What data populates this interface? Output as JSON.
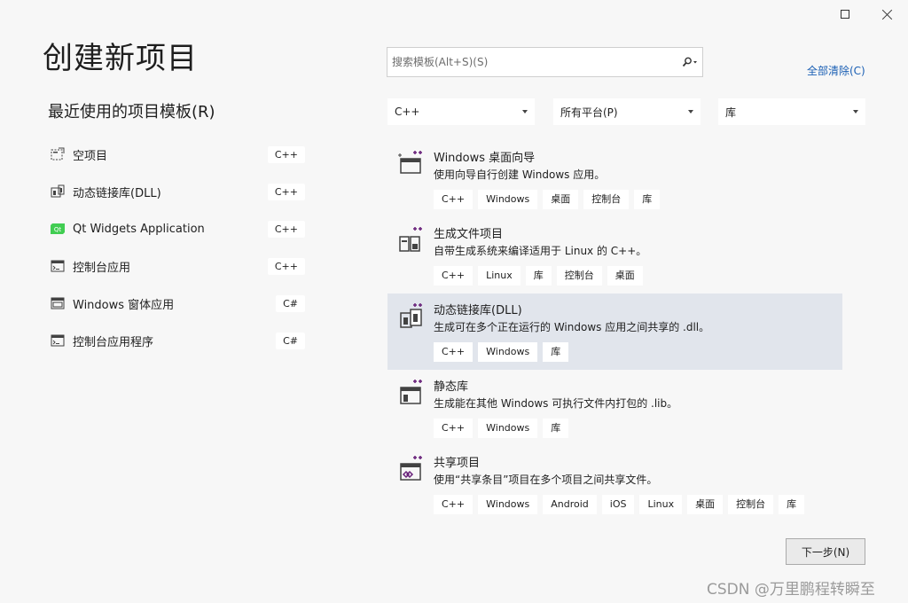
{
  "window": {
    "maximize_icon": "maximize-icon",
    "close_icon": "close-icon"
  },
  "page_title": "创建新项目",
  "recent": {
    "title": "最近使用的项目模板(R)",
    "items": [
      {
        "label": "空项目",
        "lang": "C++",
        "icon": "empty-project-icon"
      },
      {
        "label": "动态链接库(DLL)",
        "lang": "C++",
        "icon": "dll-icon"
      },
      {
        "label": "Qt Widgets Application",
        "lang": "C++",
        "icon": "qt-icon"
      },
      {
        "label": "控制台应用",
        "lang": "C++",
        "icon": "console-app-icon"
      },
      {
        "label": "Windows 窗体应用",
        "lang": "C#",
        "icon": "winforms-icon"
      },
      {
        "label": "控制台应用程序",
        "lang": "C#",
        "icon": "console-app-icon"
      }
    ]
  },
  "search": {
    "placeholder": "搜索模板(Alt+S)(S)",
    "value": ""
  },
  "clear_all": "全部清除(C)",
  "filters": {
    "language": "C++",
    "platform": "所有平台(P)",
    "type": "库"
  },
  "templates": [
    {
      "name": "Windows 桌面向导",
      "desc": "使用向导自行创建 Windows 应用。",
      "tags": [
        "C++",
        "Windows",
        "桌面",
        "控制台",
        "库"
      ],
      "icon": "desktop-wizard-icon",
      "selected": false
    },
    {
      "name": "生成文件项目",
      "desc": "自带生成系统来编译适用于 Linux 的 C++。",
      "tags": [
        "C++",
        "Linux",
        "库",
        "控制台",
        "桌面"
      ],
      "icon": "makefile-project-icon",
      "selected": false
    },
    {
      "name": "动态链接库(DLL)",
      "desc": "生成可在多个正在运行的 Windows 应用之间共享的 .dll。",
      "tags": [
        "C++",
        "Windows",
        "库"
      ],
      "icon": "dll-icon",
      "selected": true
    },
    {
      "name": "静态库",
      "desc": "生成能在其他 Windows 可执行文件内打包的 .lib。",
      "tags": [
        "C++",
        "Windows",
        "库"
      ],
      "icon": "static-lib-icon",
      "selected": false
    },
    {
      "name": "共享项目",
      "desc": "使用“共享条目”项目在多个项目之间共享文件。",
      "tags": [
        "C++",
        "Windows",
        "Android",
        "iOS",
        "Linux",
        "桌面",
        "控制台",
        "库"
      ],
      "icon": "shared-project-icon",
      "selected": false
    }
  ],
  "next_button": "下一步(N)",
  "watermark": "CSDN @万里鹏程转瞬至",
  "colors": {
    "background": "#f7f7f7",
    "selected": "#e1e5ec",
    "link": "#1a5fb4",
    "accent_purple": "#68217a",
    "qt_green": "#41cd52"
  }
}
